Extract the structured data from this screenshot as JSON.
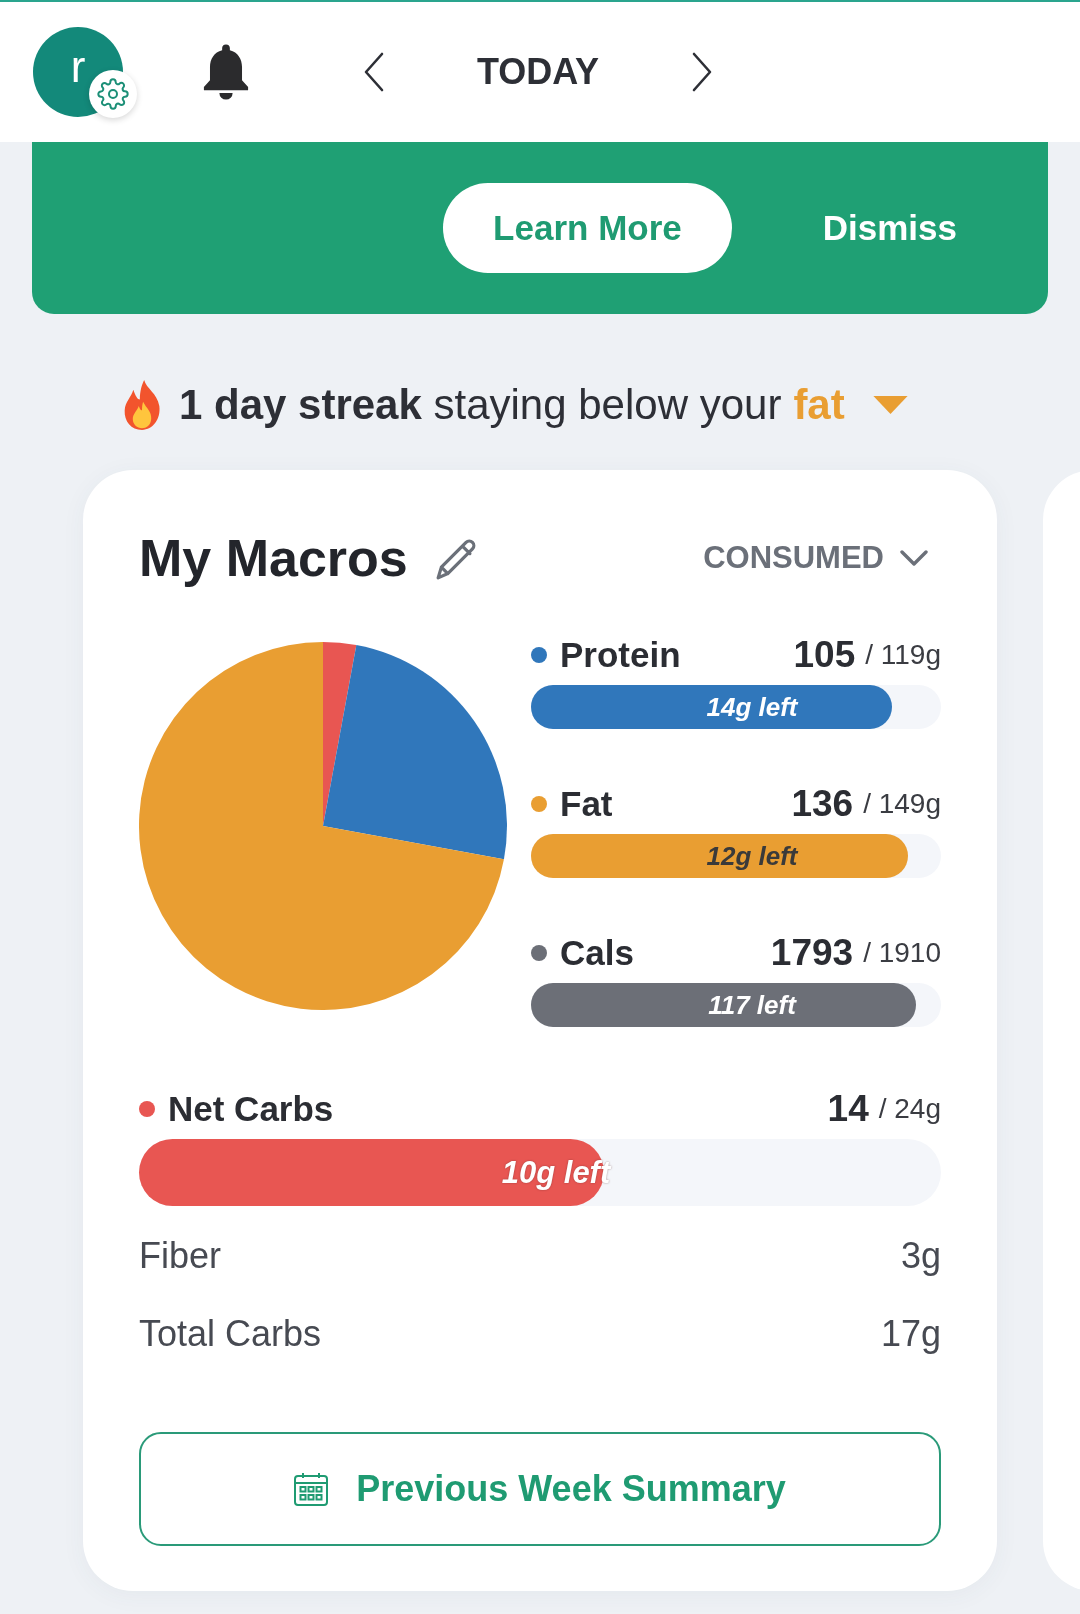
{
  "header": {
    "avatar_initial": "r",
    "title": "TODAY"
  },
  "banner": {
    "buttons": [
      {
        "label": "Learn More",
        "kind": "filled"
      },
      {
        "label": "Dismiss",
        "kind": "text"
      }
    ]
  },
  "streak": {
    "text": "**1 day streak** staying below your",
    "metric": "fat"
  },
  "macros_card": {
    "title": "My Macros",
    "view": "CONSUMED",
    "macros": [
      {
        "name": "Protein",
        "color": "#3077bb",
        "value": "105",
        "goal": "/ 119g",
        "remaining": "14g left",
        "level": 0.88
      },
      {
        "name": "Fat",
        "color": "#e99e32",
        "value": "136",
        "goal": "/ 149g",
        "remaining": "12g left",
        "level": 0.92
      },
      {
        "name": "Cals",
        "color": "#6c6f77",
        "value": "1793",
        "goal": "/ 1910",
        "remaining": "117 left",
        "level": 0.94
      }
    ],
    "net_carbs": {
      "name": "Net Carbs",
      "color": "#e85652",
      "value": "14",
      "goal": "/ 24g",
      "remaining": "10g left",
      "level": 0.58
    },
    "details": [
      {
        "label": "Fiber",
        "value": "3g"
      },
      {
        "label": "Total Carbs",
        "value": "17g"
      }
    ],
    "summary_button": "Previous Week Summary"
  }
}
